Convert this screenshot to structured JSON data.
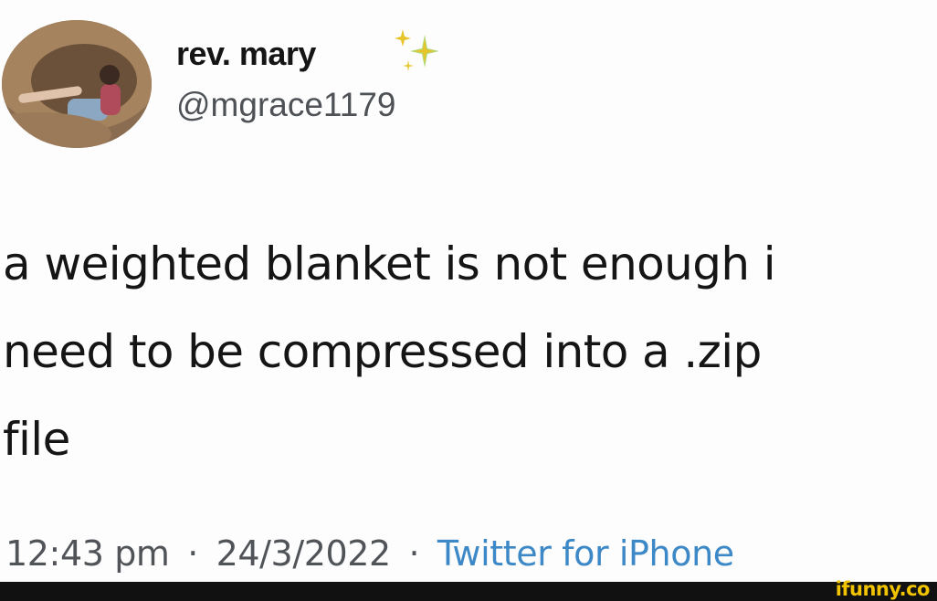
{
  "tweet": {
    "display_name": "rev. mary",
    "handle": "@mgrace1179",
    "emoji_icon": "sparkles-icon",
    "text_lines": [
      "a weighted blanket is not enough i",
      "need to be compressed into a .zip",
      "file"
    ],
    "time": "12:43 pm",
    "date": "24/3/2022",
    "separator": "·",
    "source": "Twitter for iPhone"
  },
  "watermark": {
    "text": "ifunny.co"
  },
  "colors": {
    "text": "#151515",
    "handle": "#4e5256",
    "meta": "#505358",
    "source_link": "#3d88c6",
    "sparkle_gold": "#e7c52a",
    "sparkle_green": "#9ccf57",
    "watermark": "#f2c400"
  }
}
